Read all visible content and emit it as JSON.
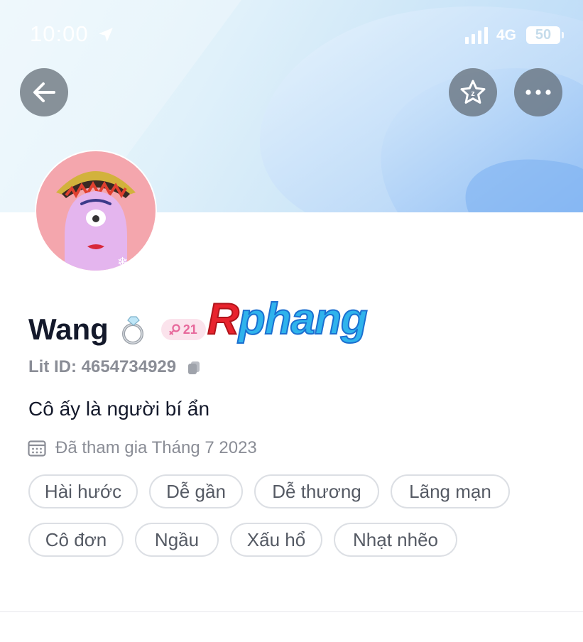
{
  "status_bar": {
    "time": "10:00",
    "network": "4G",
    "battery": "50"
  },
  "profile": {
    "name": "Wang",
    "age": "21",
    "lit_id": "Lit ID: 4654734929",
    "bio": "Cô ấy là người bí ẩn",
    "joined": "Đã tham gia Tháng 7 2023"
  },
  "watermark": {
    "first": "R",
    "rest": "phang"
  },
  "tags": [
    "Hài hước",
    "Dễ gần",
    "Dễ thương",
    "Lãng mạn",
    "Cô đơn",
    "Ngầu",
    "Xấu hổ",
    "Nhạt nhẽo"
  ],
  "icons": {
    "back": "arrow-left-icon",
    "favorite": "star-icon",
    "more": "more-dots-icon",
    "relationship": "diamond-ring-icon",
    "gender": "female-icon",
    "copy": "copy-icon",
    "calendar": "calendar-icon"
  },
  "colors": {
    "text_primary": "#14192b",
    "text_secondary": "#8a8d96",
    "gender_badge": "#e7689b"
  }
}
